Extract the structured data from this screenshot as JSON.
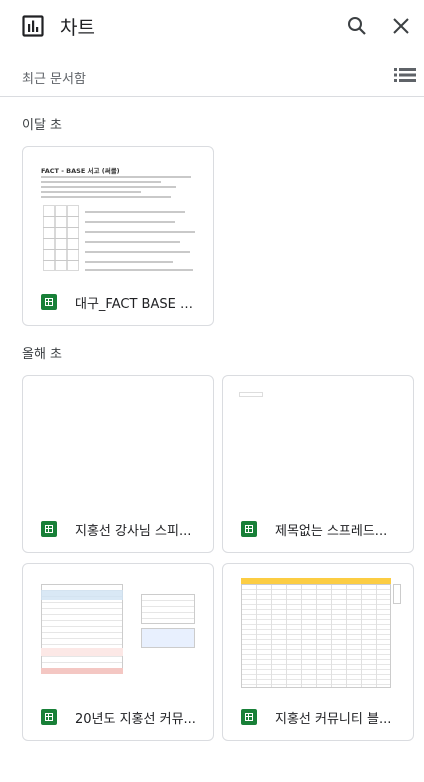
{
  "header": {
    "title": "차트",
    "chart_icon": "bar-chart-icon",
    "search_icon": "search-icon",
    "close_icon": "close-icon"
  },
  "recent": {
    "label": "최근 문서함",
    "list_icon": "list-view-icon"
  },
  "sections": {
    "this_month": "이달 초",
    "this_year": "올해 초"
  },
  "cards": [
    {
      "title": "대구_FACT BASE 사...",
      "thumb_heading": "FACT - BASE 서고 (써클)",
      "icon": "sheets-icon"
    },
    {
      "title": "지홍선 강사님 스피...",
      "icon": "sheets-icon"
    },
    {
      "title": "제목없는 스프레드...",
      "icon": "sheets-icon"
    },
    {
      "title": "20년도 지홍선 커뮤...",
      "icon": "sheets-icon"
    },
    {
      "title": "지홍선 커뮤니티 블...",
      "icon": "sheets-icon"
    }
  ],
  "colors": {
    "sheets_green": "#188038",
    "divider": "#dadce0",
    "text_secondary": "#5f6368"
  }
}
